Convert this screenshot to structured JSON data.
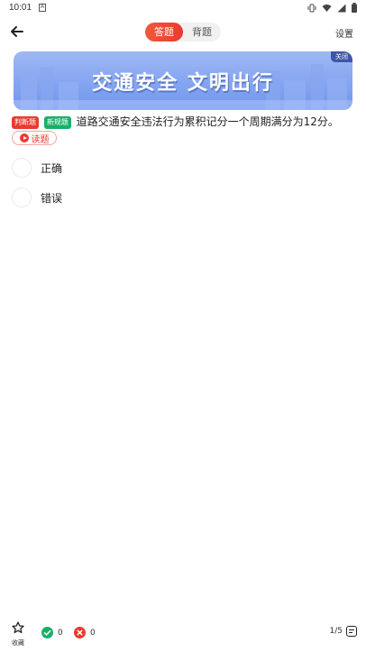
{
  "status_bar": {
    "time": "10:01",
    "notification_icon": "A"
  },
  "header": {
    "tabs": [
      {
        "label": "答题",
        "active": true
      },
      {
        "label": "背题",
        "active": false
      }
    ],
    "settings_label": "设置"
  },
  "banner": {
    "slogan": "交通安全  文明出行",
    "close_label": "关闭"
  },
  "question": {
    "type_badge": "判断题",
    "new_rule_badge": "新规题",
    "text": "道路交通安全违法行为累积记分一个周期满分为12分。",
    "read_label": "读题"
  },
  "options": [
    {
      "label": "正确"
    },
    {
      "label": "错误"
    }
  ],
  "bottom": {
    "favorite_label": "收藏",
    "correct_count": "0",
    "wrong_count": "0",
    "progress": "1/5"
  },
  "colors": {
    "accent": "#ea3a2f",
    "success": "#18b06a",
    "banner": "#6f95ee"
  }
}
